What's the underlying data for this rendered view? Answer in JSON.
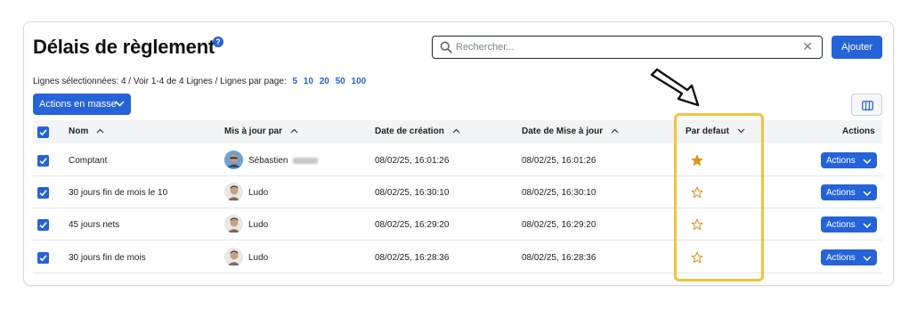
{
  "header": {
    "title": "Délais de règlement",
    "help": "?"
  },
  "search": {
    "placeholder": "Rechercher...",
    "value": ""
  },
  "add_label": "Ajouter",
  "meta": {
    "selected": "Lignes sélectionnées: 4 /",
    "view": "Voir 1-4 de 4 Lignes /",
    "per_page_label": "Lignes par page:",
    "per_page_options": [
      "5",
      "10",
      "20",
      "50",
      "100"
    ]
  },
  "bulk_label": "Actions en masse",
  "columns": {
    "name": "Nom",
    "updated_by": "Mis à jour par",
    "created": "Date de création",
    "updated": "Date de Mise à jour",
    "default": "Par defaut",
    "actions": "Actions"
  },
  "rows": [
    {
      "name": "Comptant",
      "user": "Sébastien",
      "created": "08/02/25, 16:01:26",
      "updated": "08/02/25, 16:01:26",
      "default": true,
      "actions": "Actions"
    },
    {
      "name": "30 jours fin de mois le 10",
      "user": "Ludo",
      "created": "08/02/25, 16:30:10",
      "updated": "08/02/25, 16:30:10",
      "default": false,
      "actions": "Actions"
    },
    {
      "name": "45 jours nets",
      "user": "Ludo",
      "created": "08/02/25, 16:29:20",
      "updated": "08/02/25, 16:29:20",
      "default": false,
      "actions": "Actions"
    },
    {
      "name": "30 jours fin de mois",
      "user": "Ludo",
      "created": "08/02/25, 16:28:36",
      "updated": "08/02/25, 16:28:36",
      "default": false,
      "actions": "Actions"
    }
  ],
  "colors": {
    "primary": "#2563d9",
    "highlight": "#f5c23a",
    "star": "#d9961f"
  },
  "icons": [
    "search-icon",
    "clear-icon",
    "help-icon",
    "chevron-down-icon",
    "sort-up-icon",
    "columns-icon",
    "star-filled-icon",
    "star-outline-icon",
    "check-icon",
    "arrow-callout-icon"
  ]
}
